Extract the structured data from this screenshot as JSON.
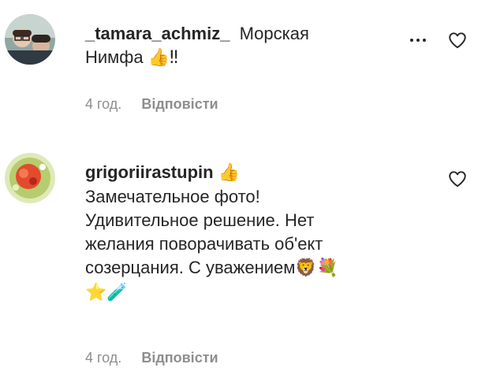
{
  "comments": [
    {
      "username": "_tamara_achmiz_",
      "lines": [
        "Морская",
        "Нимфа"
      ],
      "emoji_after": "👍‼",
      "time": "4 год.",
      "reply_label": "Відповісти"
    },
    {
      "username": "grigoriirastupin",
      "username_emoji": "👍",
      "lines": [
        "Замечательное фото!",
        "Удивительное решение. Нет",
        "желания поворачивать об'ект",
        "созерцания. С уважением"
      ],
      "emoji_line4": "🦁💐",
      "emoji_line5": "⭐🧪",
      "time": "4 год.",
      "reply_label": "Відповісти"
    }
  ],
  "icons": {
    "more": "more-options-icon",
    "like": "heart-outline-icon"
  }
}
